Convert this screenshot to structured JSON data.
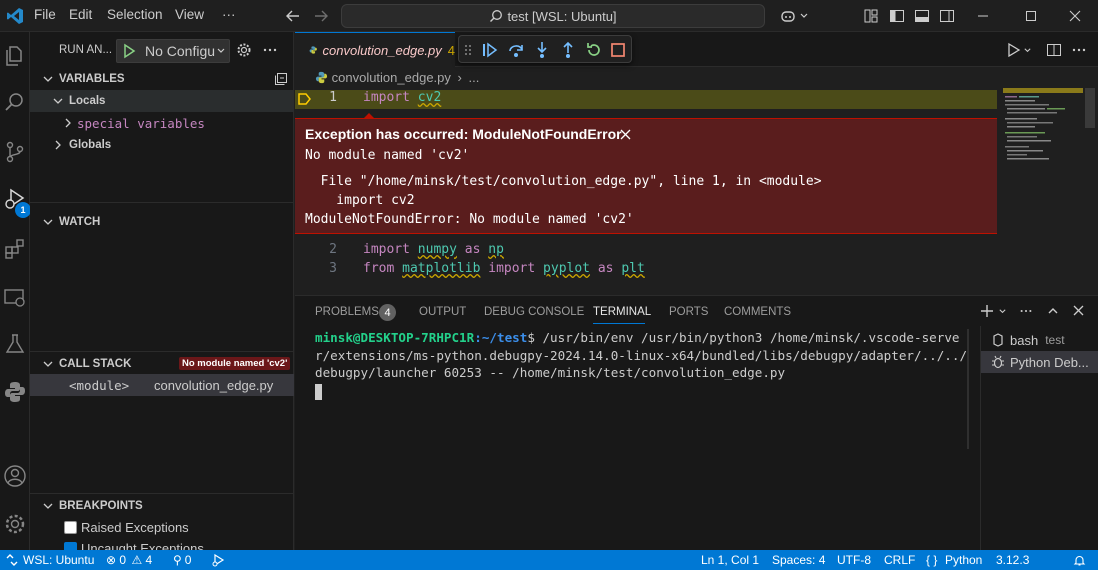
{
  "titlebar": {
    "menu": [
      "File",
      "Edit",
      "Selection",
      "View",
      "···"
    ],
    "search": "test [WSL: Ubuntu]"
  },
  "sidebar": {
    "run_label": "RUN AN...",
    "config": "No Configu",
    "variables": "VARIABLES",
    "locals": "Locals",
    "special_variables": "special variables",
    "globals": "Globals",
    "watch": "WATCH",
    "call_stack": "CALL STACK",
    "call_stack_badge": "No module named 'cv2'",
    "frame_name": "<module>",
    "frame_file": "convolution_edge.py",
    "breakpoints": "BREAKPOINTS",
    "bp_raised": "Raised Exceptions",
    "bp_uncaught": "Uncaught Exceptions"
  },
  "activity": {
    "debug_badge": "1"
  },
  "editor": {
    "tab_label": "convolution_edge.py",
    "tab_problems": "4",
    "breadcrumb_file": "convolution_edge.py",
    "breadcrumb_more": "...",
    "lines": [
      {
        "num": "1",
        "parts": [
          [
            "kw",
            "import"
          ],
          [
            "",
            " "
          ],
          [
            "mod",
            "cv2"
          ]
        ]
      },
      {
        "num": "2",
        "parts": [
          [
            "kw",
            "import"
          ],
          [
            "",
            " "
          ],
          [
            "mod",
            "numpy"
          ],
          [
            "",
            " "
          ],
          [
            "kw",
            "as"
          ],
          [
            "",
            " "
          ],
          [
            "mod",
            "np"
          ]
        ]
      },
      {
        "num": "3",
        "parts": [
          [
            "kw",
            "from"
          ],
          [
            "",
            " "
          ],
          [
            "mod",
            "matplotlib"
          ],
          [
            "",
            " "
          ],
          [
            "kw",
            "import"
          ],
          [
            "",
            " "
          ],
          [
            "mod",
            "pyplot"
          ],
          [
            "",
            " "
          ],
          [
            "kw",
            "as"
          ],
          [
            "",
            " "
          ],
          [
            "mod",
            "plt"
          ]
        ]
      }
    ],
    "exception": {
      "title": "Exception has occurred: ModuleNotFoundError",
      "message": "No module named 'cv2'",
      "trace1": "  File \"/home/minsk/test/convolution_edge.py\", line 1, in <module>",
      "trace2": "    import cv2",
      "trace3": "ModuleNotFoundError: No module named 'cv2'"
    }
  },
  "panel": {
    "tabs": [
      "PROBLEMS",
      "OUTPUT",
      "DEBUG CONSOLE",
      "TERMINAL",
      "PORTS",
      "COMMENTS"
    ],
    "problems_count": "4",
    "prompt_user": "minsk@DESKTOP-7RHPC1R",
    "prompt_path": ":~/test",
    "command": "$  /usr/bin/env /usr/bin/python3 /home/minsk/.vscode-server/extensions/ms-python.debugpy-2024.14.0-linux-x64/bundled/libs/debugpy/adapter/../../debugpy/launcher 60253 -- /home/minsk/test/convolution_edge.py",
    "terminals": [
      {
        "name": "bash",
        "detail": "test"
      },
      {
        "name": "Python Deb...",
        "detail": ""
      }
    ]
  },
  "statusbar": {
    "remote": "WSL: Ubuntu",
    "errors": "0",
    "warnings": "4",
    "ports": "0",
    "position": "Ln 1, Col 1",
    "spaces": "Spaces: 4",
    "encoding": "UTF-8",
    "eol": "CRLF",
    "language": "Python",
    "version": "3.12.3"
  },
  "colors": {
    "accent": "#0078d4",
    "exception_bg": "#5a1d1d",
    "keyword": "#c586c0",
    "module": "#4ec9b0"
  }
}
